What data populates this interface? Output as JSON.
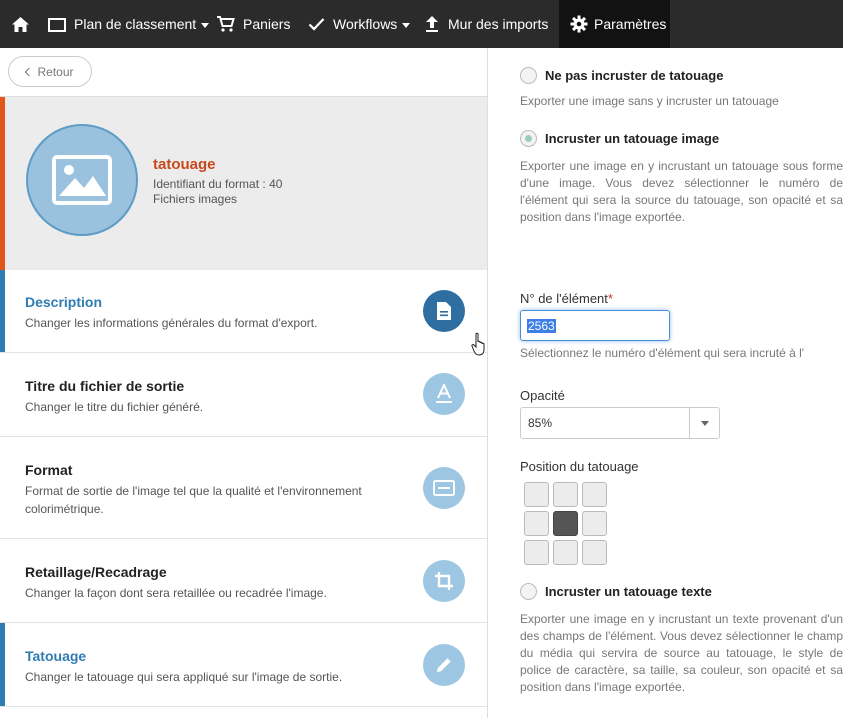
{
  "nav": {
    "home_icon": "home-icon",
    "items": [
      {
        "label": "Plan de classement",
        "icon": "folder-icon",
        "has_caret": true
      },
      {
        "label": "Paniers",
        "icon": "cart-icon",
        "has_caret": false
      },
      {
        "label": "Workflows",
        "icon": "check-icon",
        "has_caret": true
      },
      {
        "label": "Mur des imports",
        "icon": "upload-icon",
        "has_caret": false
      },
      {
        "label": "Paramètres",
        "icon": "gear-icon",
        "has_caret": false,
        "active": true
      }
    ]
  },
  "left": {
    "back_label": "Retour",
    "format": {
      "title": "tatouage",
      "id_text": "Identifiant du format : 40",
      "type_text": "Fichiers images"
    },
    "menu": [
      {
        "title": "Description",
        "desc": "Changer les informations générales du format d'export.",
        "icon": "document-icon",
        "active": true
      },
      {
        "title": "Titre du fichier de sortie",
        "desc": "Changer le titre du fichier généré.",
        "icon": "text-format-icon",
        "active": false
      },
      {
        "title": "Format",
        "desc": "Format de sortie de l'image tel que la qualité et l'environnement colorimétrique.",
        "icon": "aspect-icon",
        "active": false
      },
      {
        "title": "Retaillage/Recadrage",
        "desc": "Changer la façon dont sera retaillée ou recadrée l'image.",
        "icon": "crop-icon",
        "active": false
      },
      {
        "title": "Tatouage",
        "desc": "Changer le tatouage qui sera appliqué sur l'image de sortie.",
        "icon": "pencil-icon",
        "active": true
      }
    ]
  },
  "right": {
    "opt_none": {
      "label": "Ne pas incruster de tatouage",
      "help": "Exporter une image sans y incruster un tatouage",
      "checked": false
    },
    "opt_image": {
      "label": "Incruster un tatouage image",
      "help": "Exporter une image en y incrustant un tatouage sous forme d'une image. Vous devez sélectionner le numéro de l'élément qui sera la source du tatouage, son opacité et sa position dans l'image exportée.",
      "checked": true
    },
    "element_label": "N° de l'élément",
    "element_required": "*",
    "element_value": "2563",
    "element_help": "Sélectionnez le numéro d'élément qui sera incruté à l'",
    "opacity_label": "Opacité",
    "opacity_value": "85%",
    "position_label": "Position du tatouage",
    "position_selected": "center",
    "opt_text": {
      "label": "Incruster un tatouage texte",
      "help": "Exporter une image en y incrustant un texte provenant d'un des champs de l'élément. Vous devez sélectionner le champ du média qui servira de source au tatouage, le style de police de caractère, sa taille, sa couleur, son opacité et sa position dans l'image exportée.",
      "checked": false
    }
  }
}
